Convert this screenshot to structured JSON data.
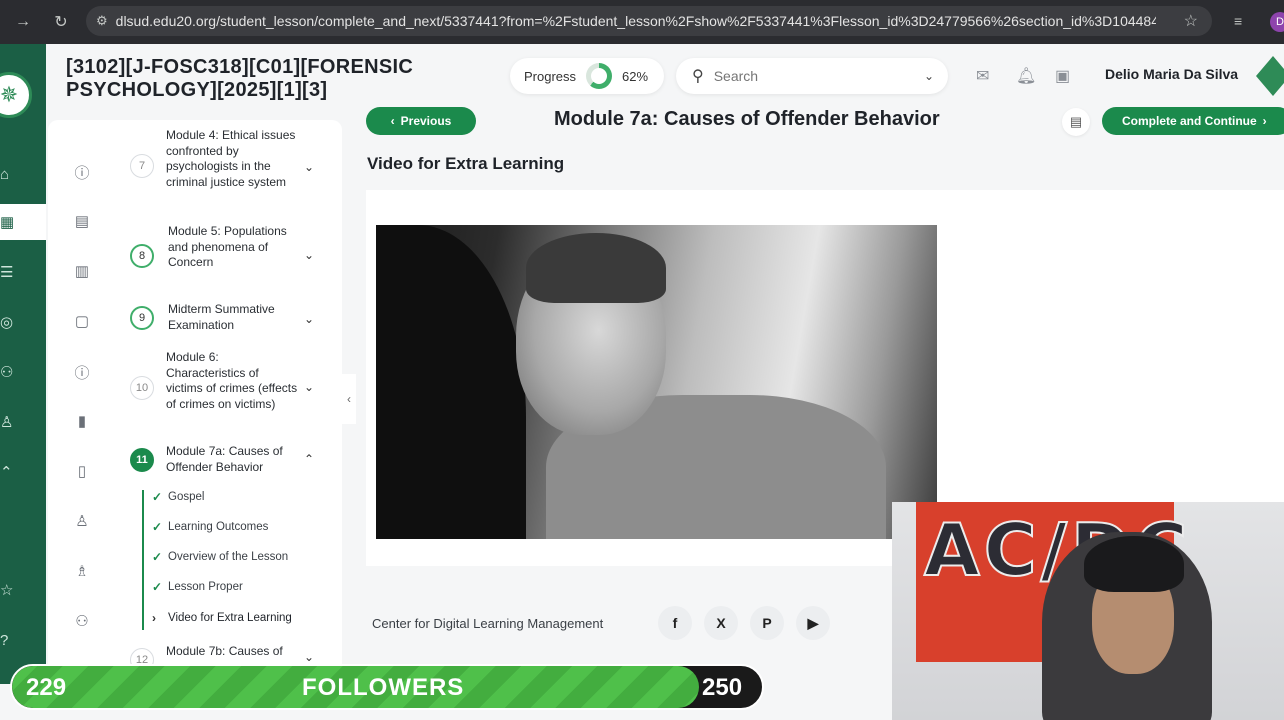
{
  "browser": {
    "url": "dlsud.edu20.org/student_lesson/complete_and_next/5337441?from=%2Fstudent_lesson%2Fshow%2F5337441%3Flesson_id%3D24779566%26section_id%3D10448439...",
    "profile_initial": "D"
  },
  "header": {
    "course_title": "[3102][J-FOSC318][C01][FORENSIC PSYCHOLOGY][2025][1][3]",
    "progress_label": "Progress",
    "progress_value": "62%",
    "progress_fraction": 0.62,
    "search_placeholder": "Search",
    "user_name": "Delio Maria Da Silva"
  },
  "outline": {
    "modules": [
      {
        "num": "7",
        "label": "Module 4: Ethical issues confronted by psychologists in the criminal justice system"
      },
      {
        "num": "8",
        "label": "Module 5: Populations and phenomena of Concern"
      },
      {
        "num": "9",
        "label": "Midterm Summative Examination"
      },
      {
        "num": "10",
        "label": "Module 6: Characteristics of victims of crimes (effects of crimes on victims)"
      },
      {
        "num": "11",
        "label": "Module 7a: Causes of Offender Behavior"
      },
      {
        "num": "12",
        "label": "Module 7b: Causes of"
      }
    ],
    "lessons": [
      "Gospel",
      "Learning Outcomes",
      "Overview of the Lesson",
      "Lesson Proper",
      "Video for Extra Learning"
    ]
  },
  "lesson": {
    "previous_label": "Previous",
    "title": "Module 7a: Causes of Offender Behavior",
    "next_label": "Complete and Continue",
    "section_heading": "Video for Extra Learning"
  },
  "footer": {
    "text": "Center for Digital Learning Management",
    "social": [
      "f",
      "X",
      "P",
      "▶"
    ]
  },
  "overlay": {
    "followers_current": "229",
    "followers_label": "FOLLOWERS",
    "followers_goal": "250",
    "followers_fraction": 0.916,
    "flag_text": "AC/DC"
  }
}
